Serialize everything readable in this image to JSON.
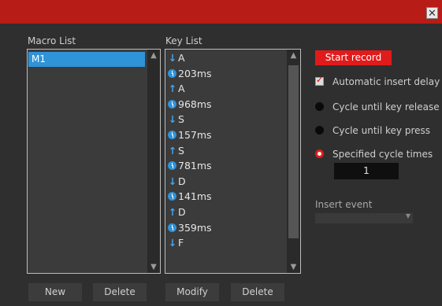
{
  "window": {
    "close_glyph": "✕"
  },
  "macro_list": {
    "label": "Macro List",
    "items": [
      {
        "label": "M1",
        "selected": true
      }
    ]
  },
  "key_list": {
    "label": "Key List",
    "items": [
      {
        "icon": "arrow-down-icon",
        "text": "A"
      },
      {
        "icon": "clock-icon",
        "text": "203ms"
      },
      {
        "icon": "arrow-up-icon",
        "text": "A"
      },
      {
        "icon": "clock-icon",
        "text": "968ms"
      },
      {
        "icon": "arrow-down-icon",
        "text": "S"
      },
      {
        "icon": "clock-icon",
        "text": "157ms"
      },
      {
        "icon": "arrow-up-icon",
        "text": "S"
      },
      {
        "icon": "clock-icon",
        "text": "781ms"
      },
      {
        "icon": "arrow-down-icon",
        "text": "D"
      },
      {
        "icon": "clock-icon",
        "text": "141ms"
      },
      {
        "icon": "arrow-up-icon",
        "text": "D"
      },
      {
        "icon": "clock-icon",
        "text": "359ms"
      },
      {
        "icon": "arrow-down-icon",
        "text": "F"
      }
    ]
  },
  "buttons": {
    "new": "New",
    "delete_macro": "Delete",
    "modify": "Modify",
    "delete_key": "Delete"
  },
  "options": {
    "start_record": "Start record",
    "auto_insert_delay": "Automatic insert delay",
    "auto_insert_delay_checked": true,
    "cycle_until_release": "Cycle until key release",
    "cycle_until_press": "Cycle until key press",
    "specified_cycle": "Specified cycle times",
    "selected_mode": "specified_cycle",
    "cycle_times": "1",
    "insert_event_label": "Insert event",
    "insert_event_value": ""
  },
  "colors": {
    "title_bar": "#b71c16",
    "accent_red": "#e11b1b",
    "selection_blue": "#2f93d8",
    "panel_bg": "#2f2f2f"
  }
}
